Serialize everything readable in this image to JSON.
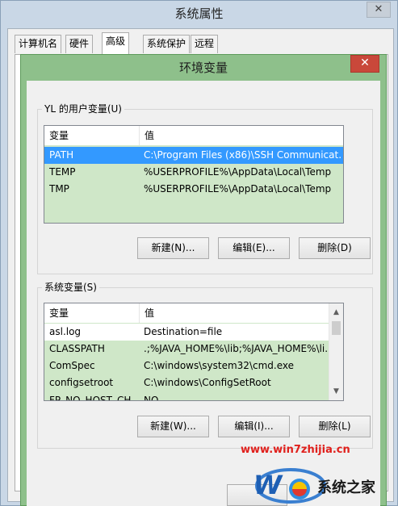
{
  "background_window": {
    "title": "系统属性",
    "close_glyph": "✕",
    "tabs": [
      "计算机名",
      "硬件",
      "高级",
      "系统保护",
      "远程"
    ],
    "active_tab": "高级"
  },
  "dialog": {
    "title": "环境变量",
    "close_glyph": "✕",
    "user_vars": {
      "legend": "YL 的用户变量(U)",
      "columns": [
        "变量",
        "值"
      ],
      "rows": [
        {
          "name": "PATH",
          "value": "C:\\Program Files (x86)\\SSH Communicat...",
          "selected": true
        },
        {
          "name": "TEMP",
          "value": "%USERPROFILE%\\AppData\\Local\\Temp",
          "selected": false
        },
        {
          "name": "TMP",
          "value": "%USERPROFILE%\\AppData\\Local\\Temp",
          "selected": false
        }
      ],
      "buttons": {
        "new": "新建(N)...",
        "edit": "编辑(E)...",
        "delete": "删除(D)"
      }
    },
    "system_vars": {
      "legend": "系统变量(S)",
      "columns": [
        "变量",
        "值"
      ],
      "rows": [
        {
          "name": "asl.log",
          "value": "Destination=file"
        },
        {
          "name": "CLASSPATH",
          "value": ".;%JAVA_HOME%\\lib;%JAVA_HOME%\\li..."
        },
        {
          "name": "ComSpec",
          "value": "C:\\windows\\system32\\cmd.exe"
        },
        {
          "name": "configsetroot",
          "value": "C:\\windows\\ConfigSetRoot"
        },
        {
          "name": "FP_NO_HOST_CH...",
          "value": "NO"
        }
      ],
      "buttons": {
        "new": "新建(W)...",
        "edit": "编辑(I)...",
        "delete": "删除(L)"
      }
    }
  },
  "watermark": {
    "url": "www.win7zhijia.cn",
    "brand": "系统之家"
  },
  "colors": {
    "dialog_frame": "#8ec08b",
    "selection": "#3399ff",
    "close_button": "#c9483a",
    "list_tint": "#cfe7c8"
  }
}
